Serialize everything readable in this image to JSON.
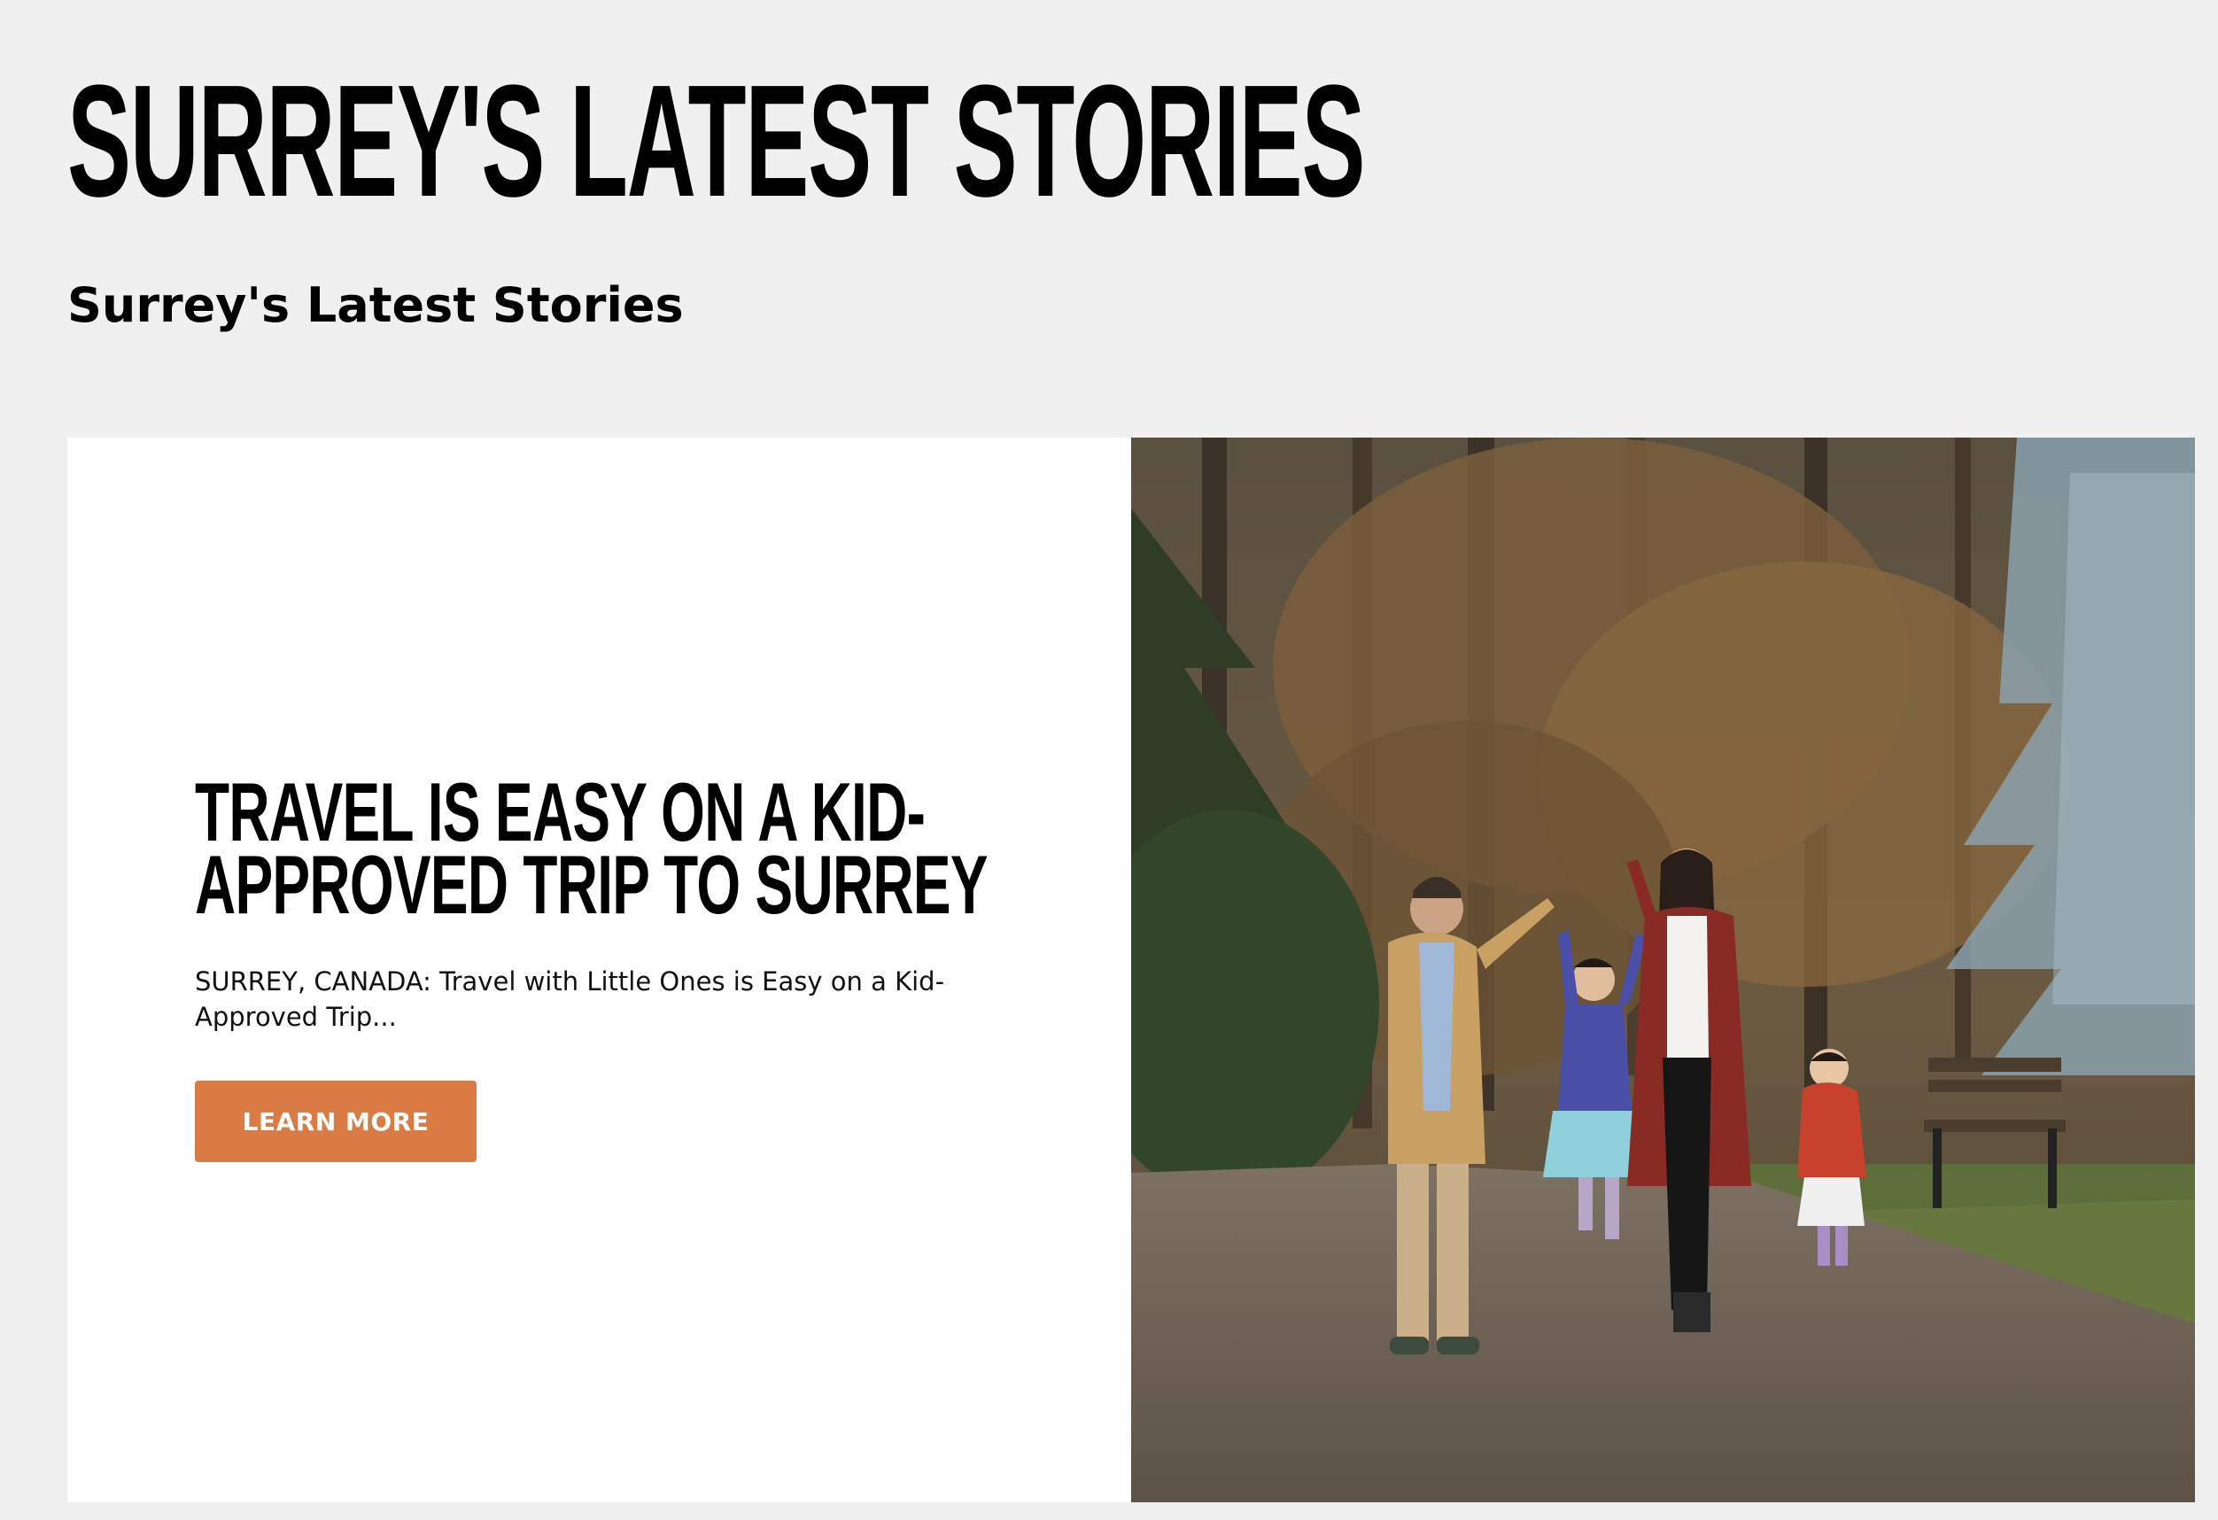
{
  "header": {
    "title": "SURREY'S LATEST STORIES",
    "subtitle": "Surrey's Latest Stories"
  },
  "story": {
    "title": "TRAVEL IS EASY ON A KID-APPROVED TRIP TO SURREY",
    "excerpt": "SURREY, CANADA: Travel with Little Ones is Easy on a Kid-Approved Trip...",
    "button_label": "LEARN MORE",
    "image_subject": "family-walking-in-park",
    "accent_color": "#d97b42"
  }
}
